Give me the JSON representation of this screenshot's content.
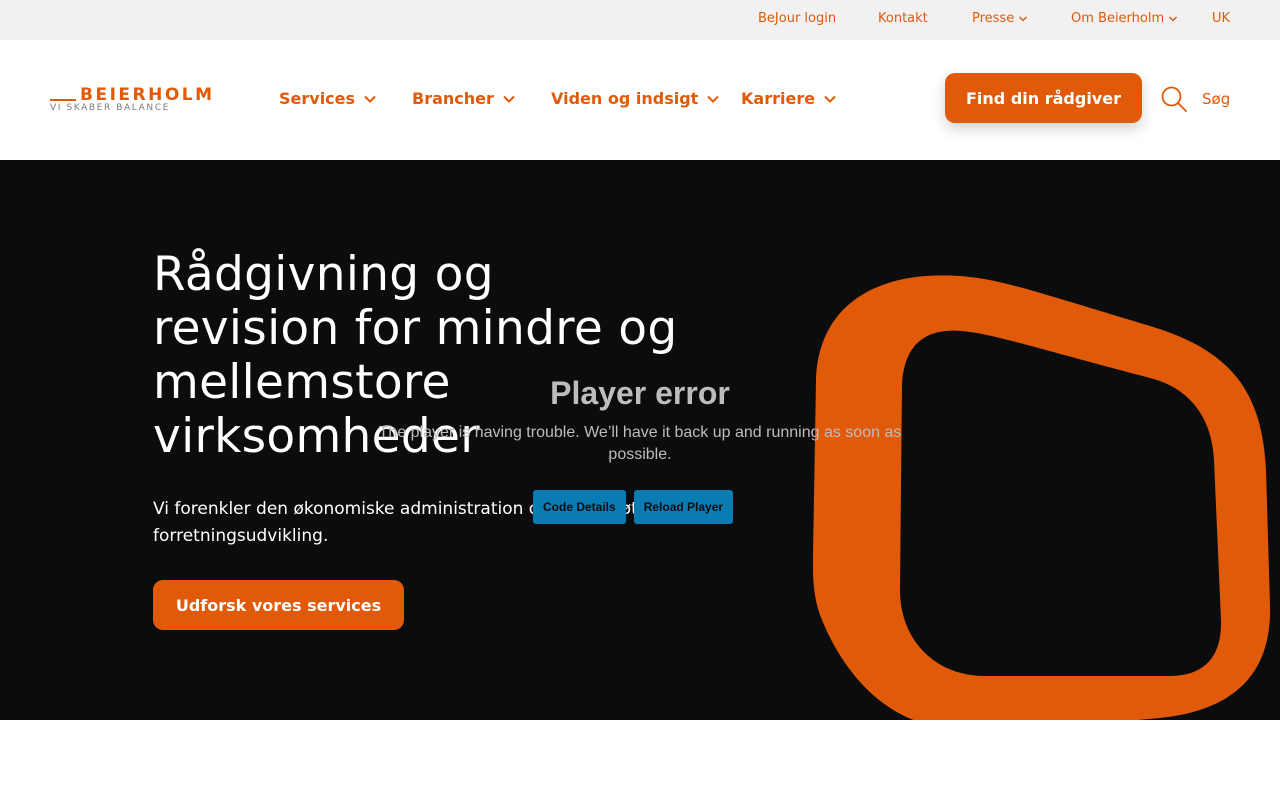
{
  "utility": {
    "links": [
      {
        "label": "BeJour login"
      },
      {
        "label": "Kontakt"
      },
      {
        "label": "Presse"
      },
      {
        "label": "Om Beierholm"
      },
      {
        "label": "UK"
      }
    ]
  },
  "header": {
    "logo_word": "BEIERHOLM",
    "logo_tagline": "VI SKABER BALANCE",
    "nav": [
      {
        "label": "Services"
      },
      {
        "label": "Brancher"
      },
      {
        "label": "Viden og indsigt"
      },
      {
        "label": "Karriere"
      }
    ],
    "cta_label": "Find din rådgiver",
    "search_label": "Søg"
  },
  "hero": {
    "title": "Rådgivning og revision for mindre og mellemstore virksomheder",
    "text": "Vi forenkler den økonomiske administration og understøtter forretningsudvikling.",
    "button_label": "Udforsk vores services"
  },
  "player_error": {
    "title": "Player error",
    "message": "The player is having trouble. We’ll have it back up and running as soon as possible.",
    "buttons": [
      {
        "label": "Code Details"
      },
      {
        "label": "Reload Player"
      }
    ]
  },
  "colors": {
    "brand": "#e05a0a",
    "hero_bg": "#0b0c0d",
    "player_button": "#0a7cb3"
  }
}
